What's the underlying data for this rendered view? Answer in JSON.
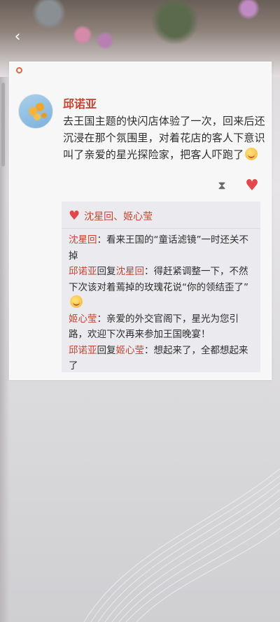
{
  "nav": {
    "back_icon": "chevron-left-icon"
  },
  "card": {
    "brand_mark": "brand-logo",
    "author": "邱诺亚",
    "text": "去王国主题的快闪店体验了一次，回来后还沉浸在那个氛围里，对着花店的客人下意识叫了亲爱的星光探险家，把客人吓跑了",
    "actions": {
      "hourglass_icon": "hourglass-icon",
      "like_icon": "heart-icon"
    },
    "likers": "沈星回、姬心莹",
    "comments": [
      {
        "author": "沈星回",
        "reply_to": "",
        "text": "：看来王国的“童话滤镜”一时还关不掉"
      },
      {
        "author": "邱诺亚",
        "reply_to": "沈星回",
        "text": "：得赶紧调整一下，不然下次该对着蔫掉的玫瑰花说“你的领结歪了”"
      },
      {
        "author": "姬心莹",
        "reply_to": "",
        "text": "：亲爱的外交官阁下，星光为您引路，欢迎下次再来参加王国晚宴！"
      },
      {
        "author": "邱诺亚",
        "reply_to": "姬心莹",
        "text": "：想起来了，全都想起来了"
      }
    ],
    "reply_word": "回复"
  },
  "colors": {
    "accent": "#c4442f",
    "heart": "#e2484b"
  }
}
